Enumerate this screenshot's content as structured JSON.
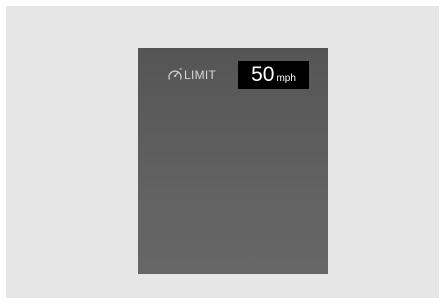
{
  "speed_limit_display": {
    "icon": "speedometer-limit-icon",
    "label": "LIMIT",
    "speed_value": "50",
    "speed_unit": "mph"
  },
  "colors": {
    "outer_background": "#e6e6e6",
    "screen_background": "#5e5e5e",
    "speed_box_background": "#000000",
    "label_text": "#d6d6d6",
    "speed_text": "#ffffff"
  }
}
